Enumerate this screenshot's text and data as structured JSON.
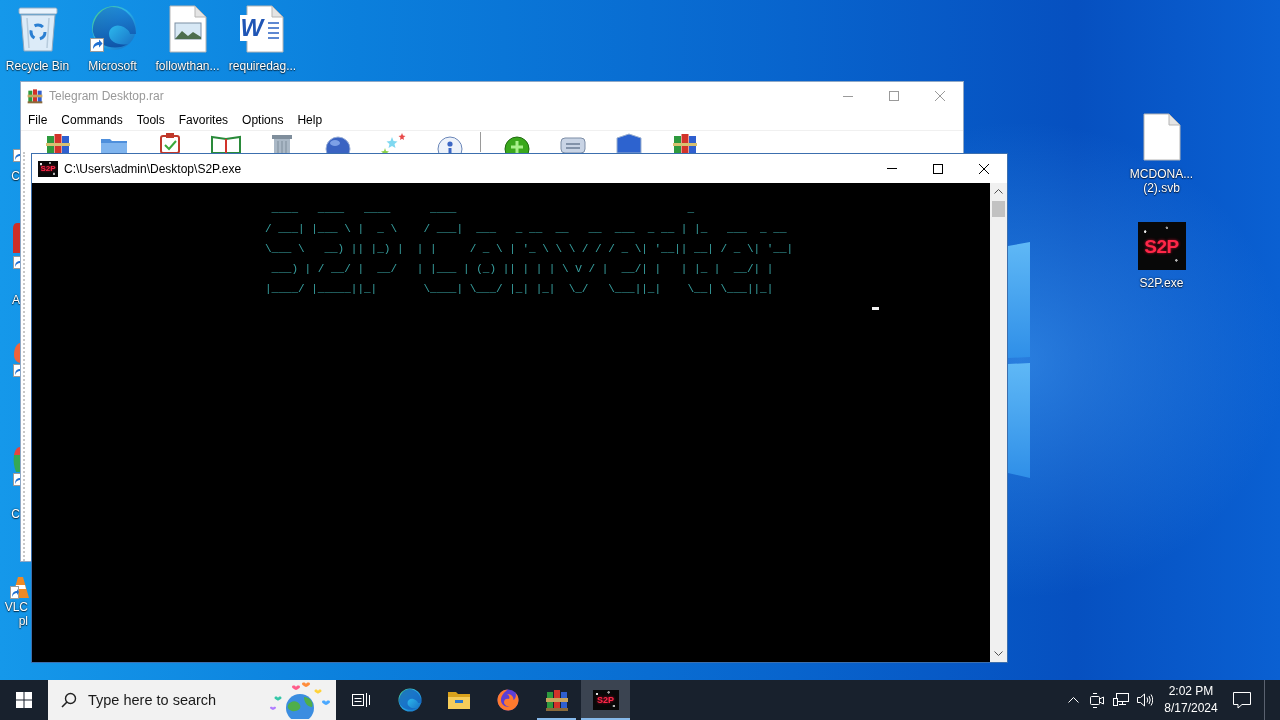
{
  "desktop": {
    "top_icons": [
      {
        "kind": "recycle-bin",
        "label": "Recycle Bin"
      },
      {
        "kind": "edge",
        "label": "Microsoft"
      },
      {
        "kind": "image-file",
        "label": "followthan..."
      },
      {
        "kind": "word-file",
        "label": "requiredag...",
        "badge": "W"
      }
    ],
    "left_icons": [
      {
        "kind": "shortcut",
        "label_lines": [
          "C"
        ]
      },
      {
        "kind": "red-app",
        "label_lines": [
          "A"
        ]
      },
      {
        "kind": "orange-app"
      },
      {
        "kind": "green-app",
        "label_lines": [
          "C"
        ]
      },
      {
        "kind": "vlc",
        "label_lines": [
          "VLC",
          "pl"
        ]
      }
    ],
    "right_icons": [
      {
        "kind": "blank-file",
        "label_lines": [
          "MCDONA...",
          "(2).svb"
        ]
      },
      {
        "kind": "s2p",
        "badge": "S2P",
        "label_lines": [
          "S2P.exe"
        ]
      }
    ]
  },
  "archiver_window": {
    "title": "Telegram Desktop.rar",
    "active": false,
    "menu": [
      "File",
      "Commands",
      "Tools",
      "Favorites",
      "Options",
      "Help"
    ],
    "toolbar": [
      {
        "kind": "add"
      },
      {
        "kind": "extract"
      },
      {
        "kind": "test"
      },
      {
        "kind": "view"
      },
      {
        "kind": "delete"
      },
      {
        "kind": "find"
      },
      {
        "kind": "wizard"
      },
      {
        "kind": "info"
      },
      {
        "kind": "separator"
      },
      {
        "kind": "repair"
      },
      {
        "kind": "comment"
      },
      {
        "kind": "protect"
      },
      {
        "kind": "sfx"
      }
    ]
  },
  "console_window": {
    "title": "C:\\Users\\admin\\Desktop\\S2P.exe",
    "icon_badge": "S2P",
    "active": true,
    "banner": [
      " ____   ____   ____      ____                                   _",
      "/ ___| |___ \\ |  _ \\    / ___|  ___   _ __  __   __  ___  _ __ | |_   ___  _ __",
      "\\___ \\   __) || |_) |  | |     / _ \\ | '_ \\ \\ \\ / / / _ \\| '__|| __| / _ \\| '__|",
      " ___) | / __/ |  __/   | |___ | (_) || | | | \\ V / |  __/| |   | |_ |  __/| |",
      "|____/ |_____||_|       \\____| \\___/ |_| |_|  \\_/   \\___||_|    \\__| \\___||_|"
    ]
  },
  "taskbar": {
    "search": {
      "placeholder": "Type here to search"
    },
    "apps": [
      {
        "kind": "task-view",
        "selected": false,
        "running": false
      },
      {
        "kind": "edge",
        "selected": false,
        "running": false
      },
      {
        "kind": "explorer",
        "selected": false,
        "running": false
      },
      {
        "kind": "firefox",
        "selected": false,
        "running": false
      },
      {
        "kind": "archiver",
        "selected": false,
        "running": true
      },
      {
        "kind": "s2p",
        "badge": "S2P",
        "selected": true,
        "running": true
      }
    ],
    "clock": {
      "time": "2:02 PM",
      "date": "8/17/2024"
    }
  }
}
